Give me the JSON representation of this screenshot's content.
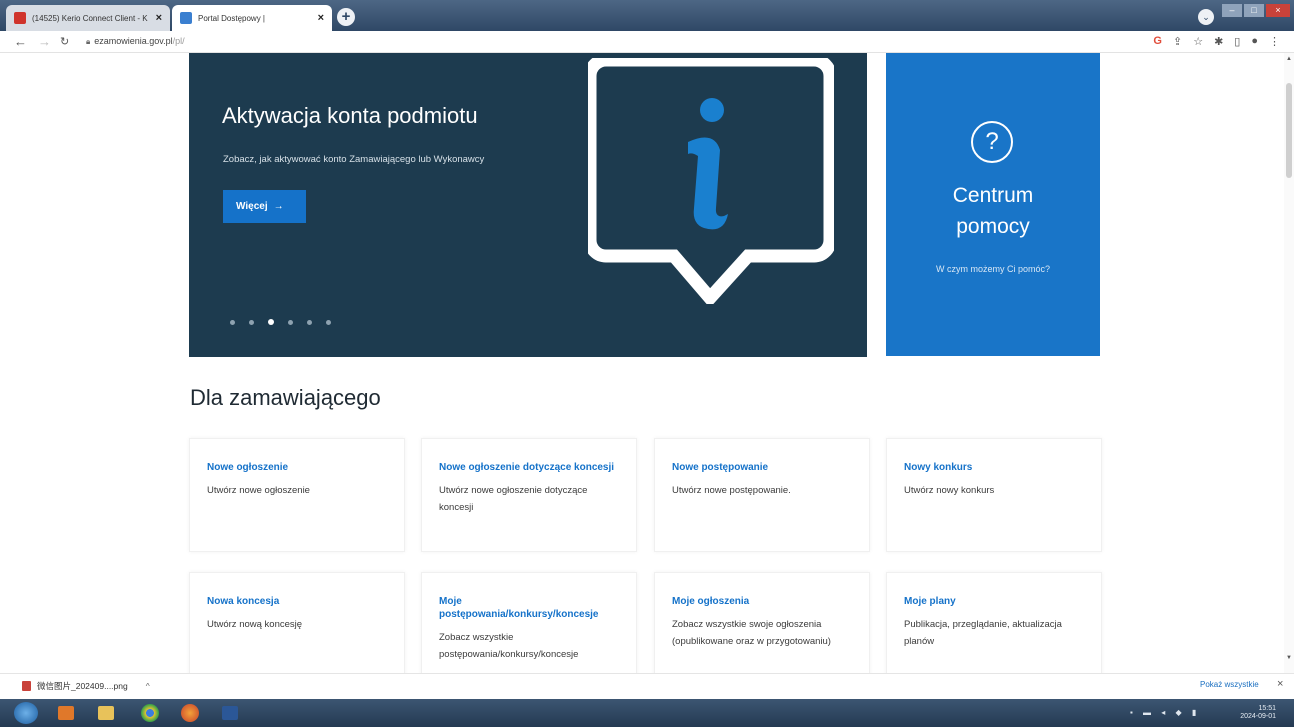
{
  "browser": {
    "tabs": [
      {
        "title": "(14525) Kerio Connect Client - K",
        "active": false
      },
      {
        "title": "Portal Dostępowy |",
        "active": true
      }
    ],
    "new_tab_label": "+",
    "url_host": "ezamowienia.gov.pl",
    "url_path": "/pl/"
  },
  "hero": {
    "title": "Aktywacja konta podmiotu",
    "subtitle": "Zobacz, jak aktywować konto Zamawiającego lub Wykonawcy",
    "button_label": "Więcej",
    "slides_count": 6,
    "active_slide": 3
  },
  "help": {
    "title_line1": "Centrum",
    "title_line2": "pomocy",
    "subtitle": "W czym możemy Ci pomóc?"
  },
  "section": {
    "title": "Dla zamawiającego"
  },
  "cards": [
    {
      "title": "Nowe ogłoszenie",
      "desc": "Utwórz nowe ogłoszenie"
    },
    {
      "title": "Nowe ogłoszenie dotyczące koncesji",
      "desc": "Utwórz nowe ogłoszenie dotyczące koncesji"
    },
    {
      "title": "Nowe postępowanie",
      "desc": "Utwórz nowe postępowanie."
    },
    {
      "title": "Nowy konkurs",
      "desc": "Utwórz nowy konkurs"
    },
    {
      "title": "Nowa koncesja",
      "desc": "Utwórz nową koncesję"
    },
    {
      "title": "Moje postępowania/konkursy/koncesje",
      "desc": "Zobacz wszystkie postępowania/konkursy/koncesje"
    },
    {
      "title": "Moje ogłoszenia",
      "desc": "Zobacz wszystkie swoje ogłoszenia (opublikowane oraz w przygotowaniu)"
    },
    {
      "title": "Moje plany",
      "desc": "Publikacja, przeglądanie, aktualizacja planów"
    }
  ],
  "downloads": {
    "file_name": "微信图片_202409....png",
    "show_all": "Pokaż wszystkie"
  },
  "taskbar": {
    "time": "15:51",
    "date": "2024-09-01"
  },
  "colors": {
    "hero_bg": "#1d3b4f",
    "accent_blue": "#1572c9",
    "help_bg": "#1975c8"
  }
}
